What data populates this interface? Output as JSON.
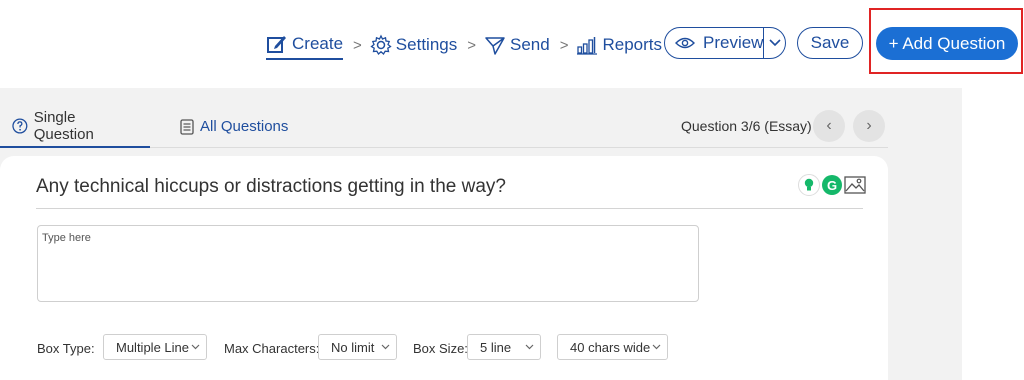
{
  "steps": [
    {
      "label": "Create",
      "icon": "edit-icon"
    },
    {
      "label": "Settings",
      "icon": "gear-icon"
    },
    {
      "label": "Send",
      "icon": "send-icon"
    },
    {
      "label": "Reports",
      "icon": "bar-chart-icon"
    }
  ],
  "step_separator": ">",
  "header": {
    "preview_label": "Preview",
    "save_label": "Save",
    "add_question_label": "+ Add Question"
  },
  "tabs": {
    "single_label": "Single Question",
    "all_label": "All Questions"
  },
  "question_nav": {
    "position": "Question 3/6 (Essay)",
    "prev": "‹",
    "next": "›"
  },
  "question": {
    "title": "Any technical hiccups or distractions getting in the way?",
    "placeholder": "Type here"
  },
  "options": {
    "box_type_label": "Box Type:",
    "box_type_value": "Multiple Line",
    "max_chars_label": "Max Characters:",
    "max_chars_value": "No limit",
    "box_size_label": "Box Size:",
    "box_size_value": "5 line",
    "width_value": "40 chars wide"
  },
  "colors": {
    "accent": "#1f4e9e",
    "primary_button": "#1b6fd4",
    "highlight": "#e02424"
  }
}
